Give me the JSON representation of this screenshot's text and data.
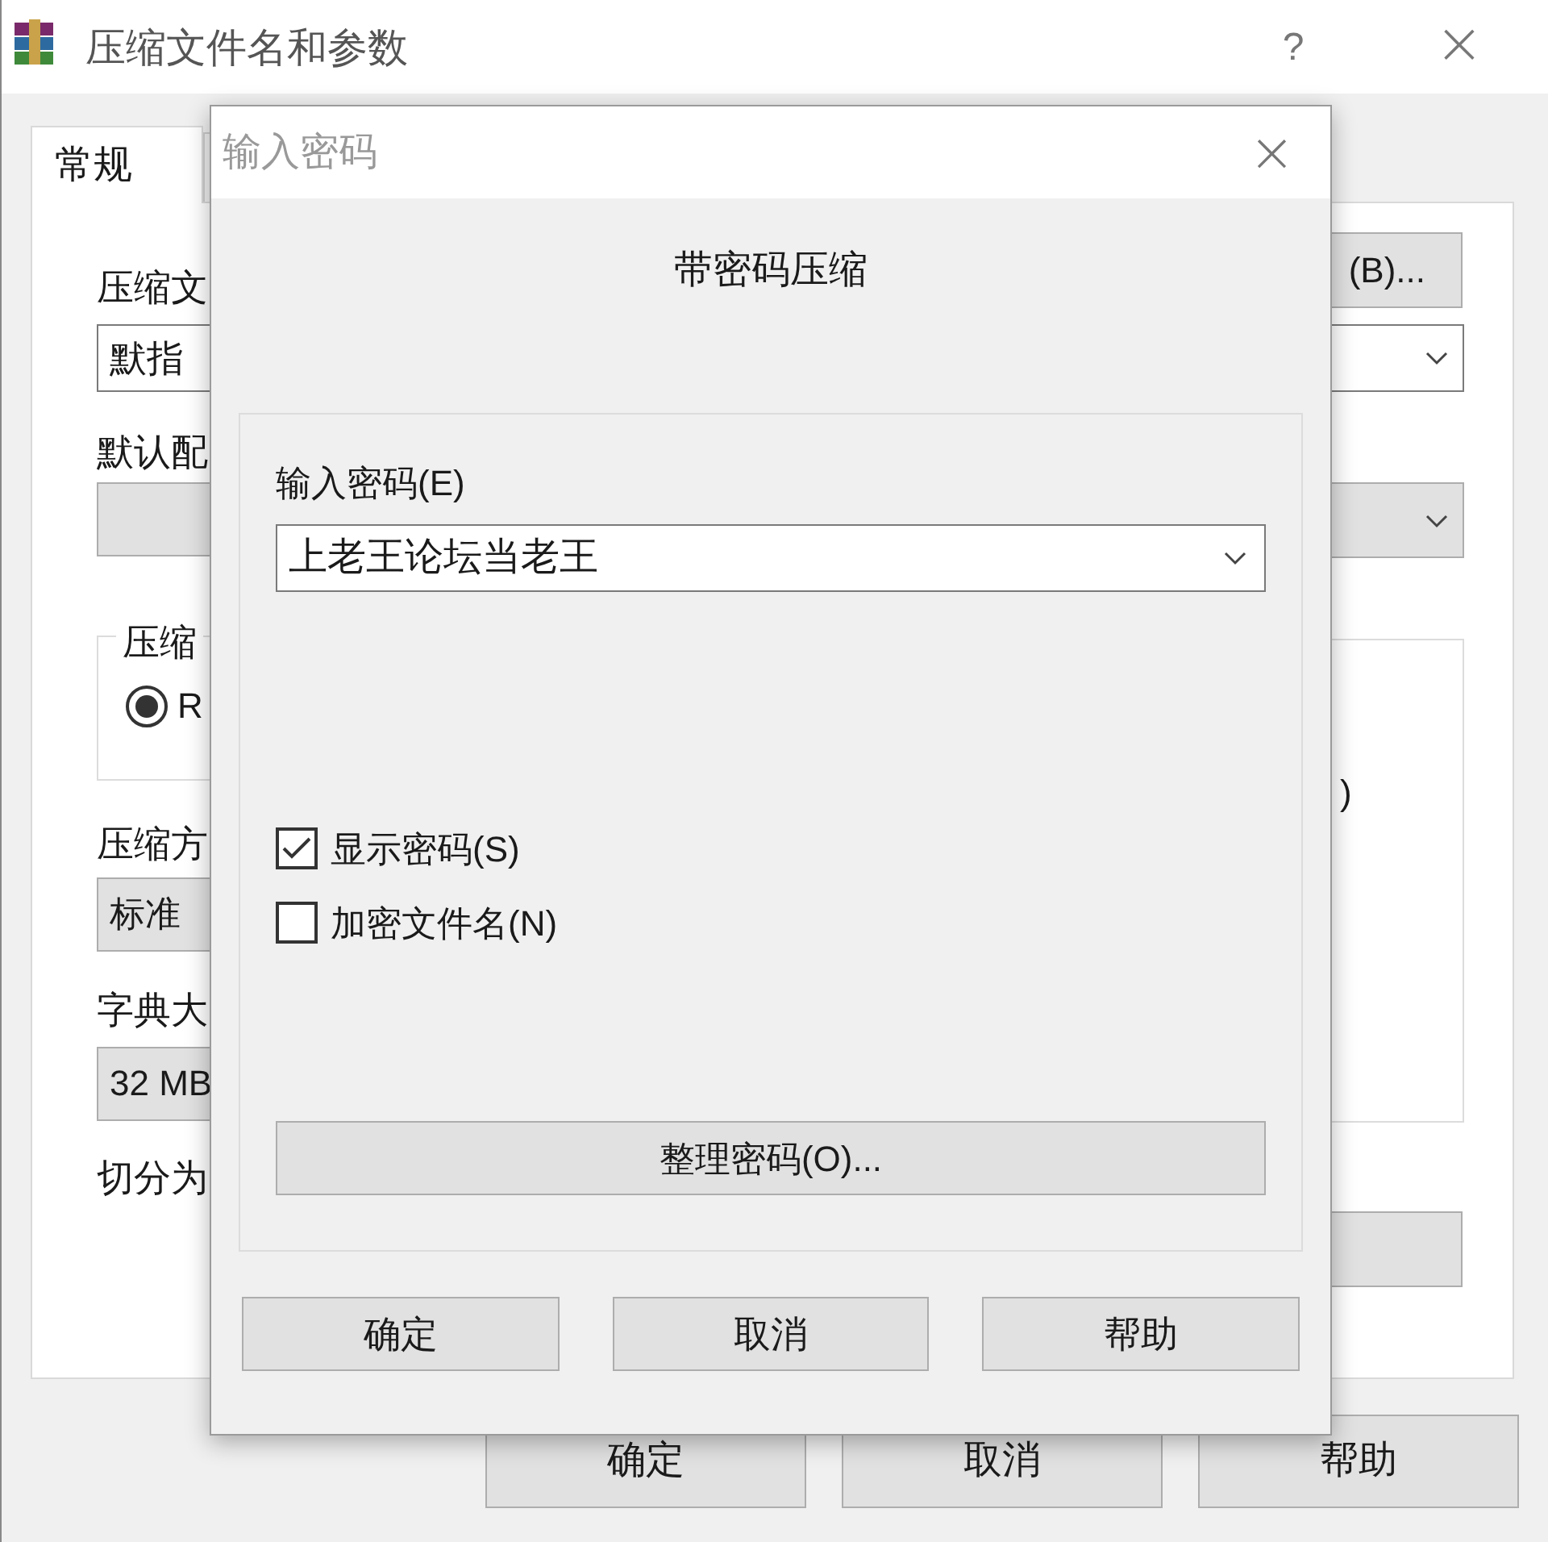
{
  "main_window": {
    "title": "压缩文件名和参数",
    "help_glyph": "?",
    "close_glyph": "×",
    "tabs": [
      {
        "label": "常规",
        "selected": true
      }
    ],
    "left_column": [
      {
        "kind": "label",
        "text": "压缩文"
      },
      {
        "kind": "field",
        "text": "默指"
      },
      {
        "kind": "label",
        "text": "默认配"
      },
      {
        "kind": "dropdown"
      },
      {
        "kind": "group",
        "text": "压缩"
      },
      {
        "kind": "radio",
        "text": "R",
        "selected": true
      },
      {
        "kind": "label",
        "text": "压缩方"
      },
      {
        "kind": "dropdown",
        "text": "标准"
      },
      {
        "kind": "label",
        "text": "字典大"
      },
      {
        "kind": "dropdown",
        "text": "32 MB"
      },
      {
        "kind": "label",
        "text": "切分为"
      }
    ],
    "right_column": [
      {
        "kind": "button",
        "text": "(B)..."
      },
      {
        "kind": "combo"
      },
      {
        "kind": "dropdown"
      },
      {
        "kind": "list",
        "text": ")"
      },
      {
        "kind": "button"
      }
    ],
    "buttons": [
      "确定",
      "取消",
      "帮助"
    ]
  },
  "password_dialog": {
    "title": "输入密码",
    "close_glyph": "×",
    "heading": "带密码压缩",
    "password_label": "输入密码(E)",
    "password_value": "上老王论坛当老王",
    "checkboxes": [
      {
        "label": "显示密码(S)",
        "checked": true
      },
      {
        "label": "加密文件名(N)",
        "checked": false
      }
    ],
    "organize_button": "整理密码(O)...",
    "buttons": [
      "确定",
      "取消",
      "帮助"
    ]
  }
}
